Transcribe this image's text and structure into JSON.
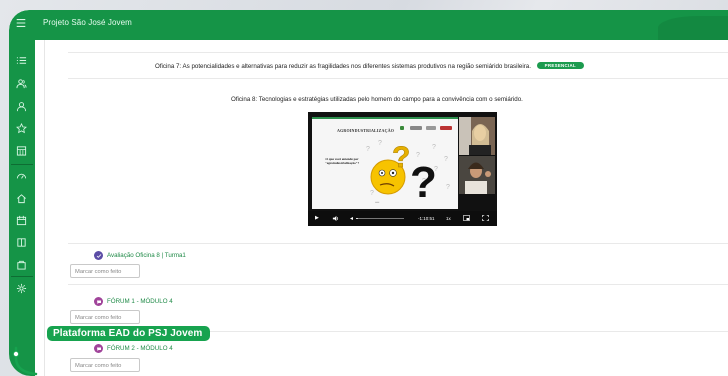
{
  "app": {
    "title": "Projeto São José Jovem"
  },
  "sidebar": {
    "icons": [
      "list-icon",
      "users-icon",
      "user-group-icon",
      "star-icon",
      "calendar-grid-icon",
      "dashboard-icon",
      "home-icon",
      "calendar-icon",
      "book-icon",
      "bag-icon",
      "gear-icon"
    ]
  },
  "course": {
    "oficina7": {
      "text": "Oficina 7: As potencialidades e alternativas para reduzir as fragilidades nos diferentes sistemas produtivos na região semiárido brasileira.",
      "badge": "PRESENCIAL"
    },
    "oficina8": {
      "text": "Oficina 8: Tecnologias e estratégias utilizadas pelo homem do campo para a convivência com o semiárido."
    },
    "video": {
      "slide_heading": "AGROINDUSTRIALIZAÇÃO",
      "slide_question": "O que você entende por \"agroindustrialização\"?",
      "time_remaining": "-1:10:51",
      "speed": "1x",
      "progress": 0.04
    },
    "activities": [
      {
        "label": "Avaliação Oficina 8 | Turma1",
        "button": "Marcar como feito",
        "icon_color": "#5b4da6"
      },
      {
        "label": "FÓRUM 1 - MÓDULO 4",
        "button": "Marcar como feito",
        "icon_color": "#a0449a"
      },
      {
        "label": "FÓRUM 2 - MÓDULO 4",
        "button": "Marcar como feito",
        "icon_color": "#a0449a"
      }
    ]
  },
  "banner": {
    "text": "Plataforma EAD do PSJ Jovem"
  },
  "colors": {
    "brand_green": "#159447",
    "badge_green": "#1c9b4f",
    "link_green": "#1f8a47"
  }
}
